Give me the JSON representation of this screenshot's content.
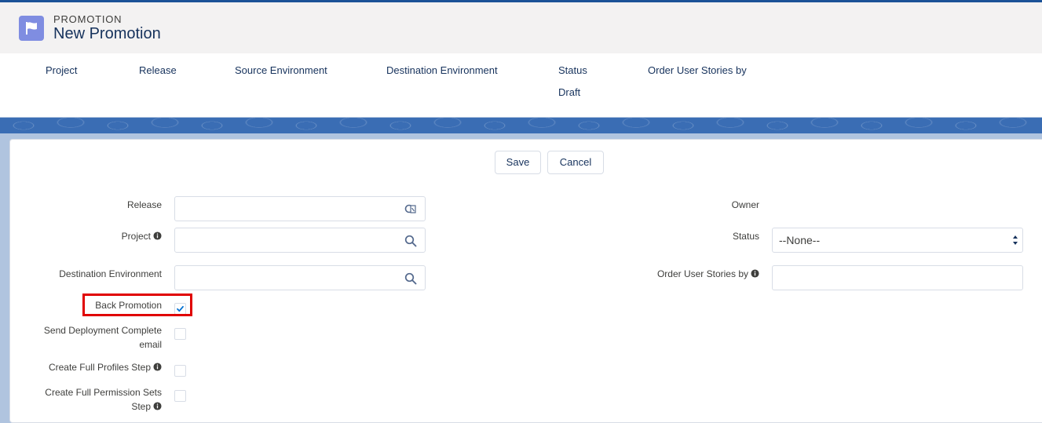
{
  "header": {
    "object_type": "PROMOTION",
    "title": "New Promotion",
    "icon": "flag-icon",
    "fields": [
      {
        "label": "Project",
        "value": ""
      },
      {
        "label": "Release",
        "value": ""
      },
      {
        "label": "Source Environment",
        "value": ""
      },
      {
        "label": "Destination Environment",
        "value": ""
      },
      {
        "label": "Status",
        "value": "Draft"
      },
      {
        "label": "Order User Stories by",
        "value": ""
      }
    ]
  },
  "actions": {
    "save_label": "Save",
    "cancel_label": "Cancel"
  },
  "form": {
    "release": {
      "label": "Release",
      "value": "",
      "icon": "lookup-search-icon"
    },
    "project": {
      "label": "Project",
      "value": "",
      "icon": "search-icon",
      "info_icon": "info-icon"
    },
    "destination_environment": {
      "label": "Destination Environment",
      "value": "",
      "icon": "search-icon"
    },
    "back_promotion": {
      "label": "Back Promotion",
      "checked": true
    },
    "send_deployment_complete_email": {
      "label": "Send Deployment Complete email",
      "checked": false
    },
    "create_full_profiles_step": {
      "label": "Create Full Profiles Step",
      "checked": false,
      "info_icon": "info-icon"
    },
    "create_full_permission_sets_step": {
      "label": "Create Full Permission Sets Step",
      "checked": false,
      "info_icon": "info-icon"
    },
    "owner": {
      "label": "Owner",
      "value": ""
    },
    "status": {
      "label": "Status",
      "selected": "--None--"
    },
    "order_user_stories_by": {
      "label": "Order User Stories by",
      "value": "",
      "info_icon": "info-icon"
    }
  },
  "colors": {
    "brand_blue": "#1b5297",
    "icon_purple": "#7f8de1",
    "title_text": "#16325c",
    "highlight_red": "#e00000"
  }
}
